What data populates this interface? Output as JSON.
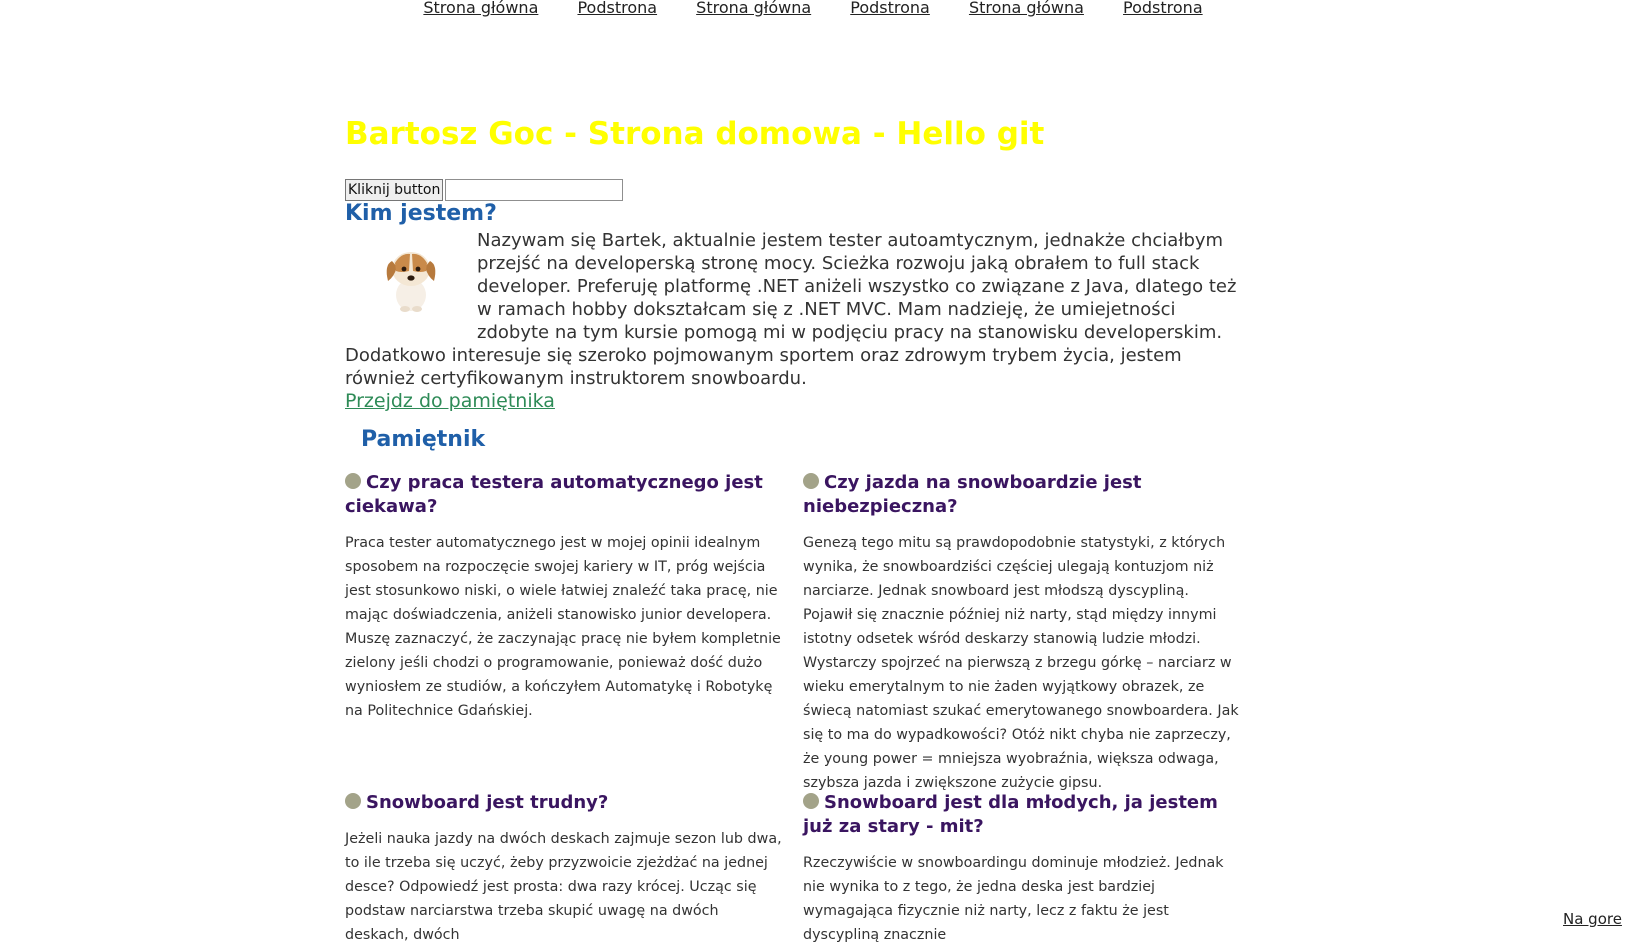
{
  "nav": {
    "items": [
      "Strona główna",
      "Podstrona",
      "Strona główna",
      "Podstrona",
      "Strona główna",
      "Podstrona"
    ]
  },
  "header": {
    "title": "Bartosz Goc - Strona domowa - Hello git"
  },
  "controls": {
    "button_label": "Kliknij button",
    "input_value": "",
    "input_placeholder": ""
  },
  "about": {
    "heading": "Kim jestem?",
    "text": "Nazywam się Bartek, aktualnie jestem tester autoamtycznym, jednakże chciałbym przejść na developerską stronę mocy. Scieżka rozwoju jaką obrałem to full stack developer. Preferuję platformę .NET aniżeli wszystko co związane z Java, dlatego też w ramach hobby dokształcam się z .NET MVC. Mam nadzieję, że umiejetności zdobyte na tym kursie pomogą mi w podjęciu pracy na stanowisku developerskim. Dodatkowo interesuje się szeroko pojmowanym sportem oraz zdrowym trybem życia, jestem również certyfikowanym instruktorem snowboardu.",
    "link": "Przejdz do pamiętnika"
  },
  "diary": {
    "heading": "Pamiętnik",
    "entries": [
      {
        "title": "Czy praca testera automatycznego jest ciekawa?",
        "text": "Praca tester automatycznego jest w mojej opinii idealnym sposobem na rozpoczęcie swojej kariery w IT, próg wejścia jest stosunkowo niski, o wiele łatwiej znaleźć taka pracę, nie mając doświadczenia, aniżeli stanowisko junior developera. Muszę zaznaczyć, że zaczynając pracę nie byłem kompletnie zielony jeśli chodzi o programowanie, ponieważ dość dużo wyniosłem ze studiów, a kończyłem Automatykę i Robotykę na Politechnice Gdańskiej."
      },
      {
        "title": "Czy jazda na snowboardzie jest niebezpieczna?",
        "text": "Genezą tego mitu są prawdopodobnie statystyki, z których wynika, że snowboardziści częściej ulegają kontuzjom niż narciarze. Jednak snowboard jest młodszą dyscypliną. Pojawił się znacznie później niż narty, stąd między innymi istotny odsetek wśród deskarzy stanowią ludzie młodzi. Wystarczy spojrzeć na pierwszą z brzegu górkę – narciarz w wieku emerytalnym to nie żaden wyjątkowy obrazek, ze świecą natomiast szukać emerytowanego snowboardera. Jak się to ma do wypadkowości? Otóż nikt chyba nie zaprzeczy, że young power = mniejsza wyobraźnia, większa odwaga, szybsza jazda i zwiększone zużycie gipsu."
      },
      {
        "title": "Snowboard jest trudny?",
        "text": "Jeżeli nauka jazdy na dwóch deskach zajmuje sezon lub dwa, to ile trzeba się uczyć, żeby przyzwoicie zjeżdżać na jednej desce? Odpowiedź jest prosta: dwa razy krócej. Ucząc się podstaw narciarstwa trzeba skupić uwagę na dwóch deskach, dwóch"
      },
      {
        "title": "Snowboard jest dla młodych, ja jestem już za stary - mit?",
        "text": "Rzeczywiście w snowboardingu dominuje młodzież. Jednak nie wynika to z tego, że jedna deska jest bardziej wymagająca fizycznie niż narty, lecz z faktu że jest dyscypliną znacznie"
      }
    ]
  },
  "footer": {
    "back_to_top": "Na gore"
  },
  "colors": {
    "title": "#ffff00",
    "heading": "#1f5fa8",
    "entry_heading": "#3a1560",
    "link": "#2e8b57",
    "bullet": "#a3a389"
  }
}
